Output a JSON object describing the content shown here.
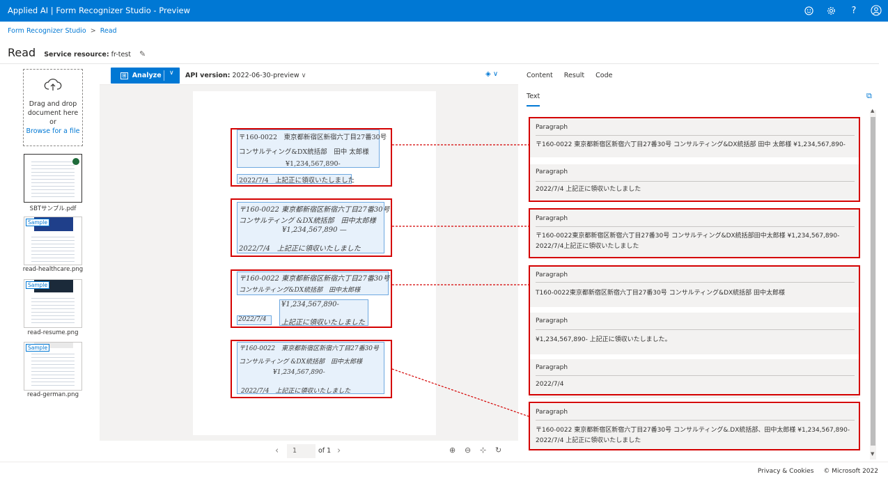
{
  "app": {
    "title": "Applied AI | Form Recognizer Studio - Preview"
  },
  "header_icons": [
    "smiley-icon",
    "gear-icon",
    "help-icon",
    "account-icon"
  ],
  "breadcrumb": {
    "root": "Form Recognizer Studio",
    "separator": ">",
    "current": "Read"
  },
  "page": {
    "title": "Read",
    "service_label": "Service resource:",
    "service_value": "fr-test"
  },
  "dropzone": {
    "line1": "Drag and drop",
    "line2": "document here",
    "or": "or",
    "browse": "Browse for a file"
  },
  "files": [
    {
      "name": "SBTサンプル.pdf",
      "selected": true,
      "badge": ""
    },
    {
      "name": "read-healthcare.png",
      "selected": false,
      "badge": "Sample"
    },
    {
      "name": "read-resume.png",
      "selected": false,
      "badge": "Sample"
    },
    {
      "name": "read-german.png",
      "selected": false,
      "badge": "Sample"
    }
  ],
  "toolbar": {
    "analyze_label": "Analyze",
    "api_label": "API version:",
    "api_value": "2022-06-30-preview"
  },
  "document": {
    "blocks": [
      {
        "lines": [
          "〒160-0022　東京都新宿区新宿六丁目27番30号",
          "コンサルティング&DX統括部　田中 太郎様",
          "¥1,234,567,890-",
          "2022/7/4　上記正に領収いたしました"
        ]
      },
      {
        "lines": [
          "〒160-0022 東京都新宿区新宿六丁目27番30号",
          "コンサルティング &DX統括部　田中太郎様",
          "¥1,234,567,890 —",
          "2022/7/4　上記正に領収いたしました"
        ]
      },
      {
        "lines": [
          "〒160-0022 東京都新宿区新宿六丁目27番30号",
          "コンサルティング&DX統括部　田中太郎様",
          "¥1,234,567,890-",
          "2022/7/4",
          "上記正に領収いたしました"
        ]
      },
      {
        "lines": [
          "〒160-0022　東京都新宿区新宿六丁目27番30号",
          "コンサルティング &DX統括部　田中太郎様",
          "¥1,234,567,890-",
          "2022/7/4　上記正に領収いたしました"
        ]
      }
    ]
  },
  "pager": {
    "page": "1",
    "of": "of 1"
  },
  "right": {
    "tabs": [
      "Content",
      "Result",
      "Code"
    ],
    "subtab": "Text",
    "paragraphs": [
      {
        "heading": "Paragraph",
        "text": "〒160-0022 東京都新宿区新宿六丁目27番30号 コンサルティング&DX統括部 田中 太郎様 ¥1,234,567,890-"
      },
      {
        "heading": "Paragraph",
        "text": "2022/7/4 上記正に領収いたしました"
      },
      {
        "heading": "Paragraph",
        "text": "〒160-0022東京都新宿区新宿六丁目27番30号 コンサルティング&DX統括部田中太郎様 ¥1,234,567,890- 2022/7/4上記正に領収いたしました"
      },
      {
        "heading": "Paragraph",
        "text": "T160-0022東京都新宿区新宿六丁目27番30号 コンサルティング&DX統括部 田中太郎様"
      },
      {
        "heading": "Paragraph",
        "text": "¥1,234,567,890- 上記正に領収いたしました。"
      },
      {
        "heading": "Paragraph",
        "text": "2022/7/4"
      },
      {
        "heading": "Paragraph",
        "text": "〒160-0022 東京都新宿区新宿六丁目27番30号 コンサルティング&.DX統括部、田中太郎様 ¥1,234,567,890- 2022/7/4 上記正に領収いたしました"
      }
    ]
  },
  "footer": {
    "privacy": "Privacy & Cookies",
    "copyright": "© Microsoft 2022"
  },
  "colors": {
    "brand": "#0078d4",
    "annotation": "#d40000"
  }
}
